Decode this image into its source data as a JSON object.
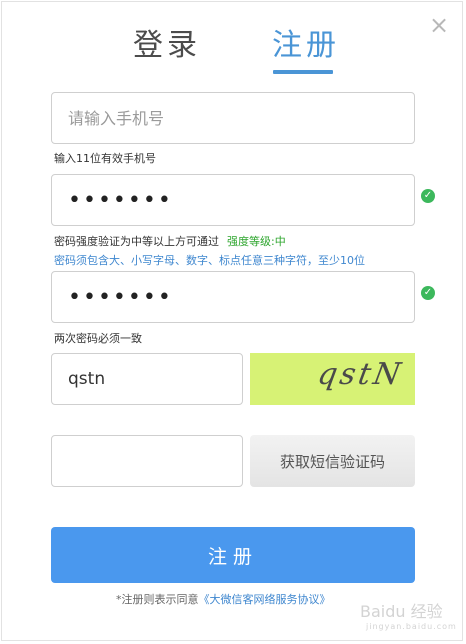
{
  "dialog": {
    "close_glyph": "×"
  },
  "tabs": {
    "login": "登录",
    "register": "注册",
    "active": "register"
  },
  "form": {
    "phone": {
      "placeholder": "请输入手机号",
      "value": "",
      "hint": "输入11位有效手机号"
    },
    "password": {
      "value": "•••••••",
      "hint": "密码强度验证为中等以上方可通过",
      "strength": "强度等级:中",
      "rule": "密码须包含大、小写字母、数字、标点任意三种字符，至少10位"
    },
    "confirm_password": {
      "value": "•••••••",
      "hint": "两次密码必须一致"
    },
    "captcha": {
      "value": "qstn",
      "image_text": "qstN"
    },
    "sms_code": {
      "value": "",
      "button_label": "获取短信验证码"
    },
    "submit_label": "注册",
    "agreement_prefix": "*注册则表示同意",
    "agreement_link": "《大微信客网络服务协议》"
  },
  "watermark": {
    "main": "Baidu 经验",
    "sub": "jingyan.baidu.com"
  },
  "colors": {
    "accent": "#4a95d6",
    "submit": "#4a98ee",
    "success": "#3cb85c",
    "captcha_bg": "#d7f275"
  },
  "icons": [
    "close-icon",
    "check-circle-icon"
  ]
}
